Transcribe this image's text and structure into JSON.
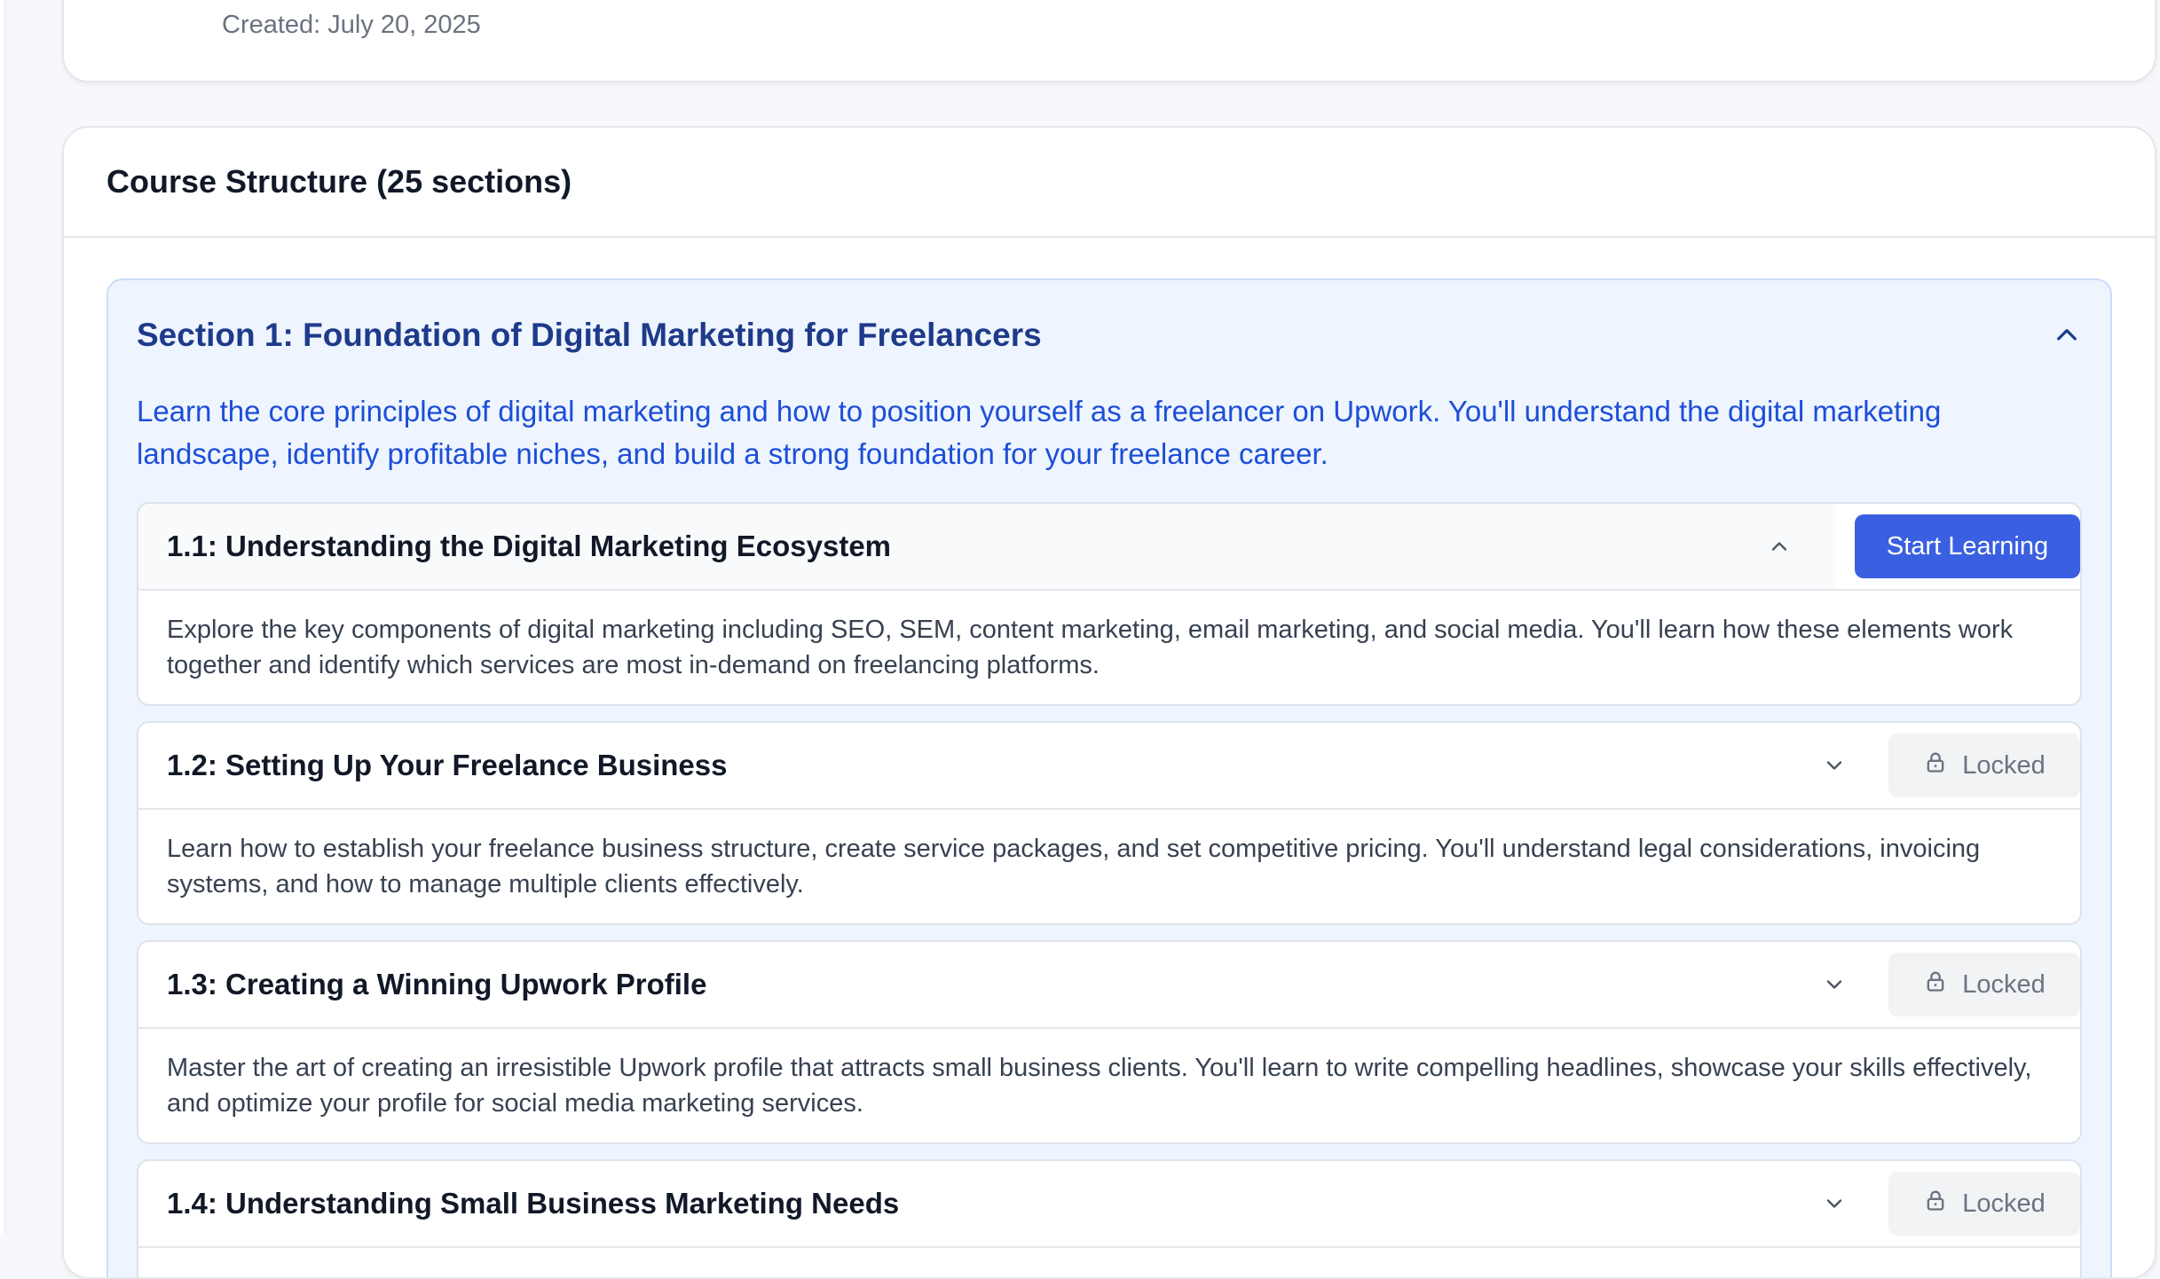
{
  "top_card": {
    "created": "Created: July 20, 2025"
  },
  "course": {
    "title": "Course Structure (25 sections)",
    "section": {
      "title": "Section 1: Foundation of Digital Marketing for Freelancers",
      "description": "Learn the core principles of digital marketing and how to position yourself as a freelancer on Upwork. You'll understand the digital marketing landscape, identify profitable niches, and build a strong foundation for your freelance career.",
      "expanded": true
    },
    "lessons": [
      {
        "title": "1.1: Understanding the Digital Marketing Ecosystem",
        "body": "Explore the key components of digital marketing including SEO, SEM, content marketing, email marketing, and social media. You'll learn how these elements work together and identify which services are most in-demand on freelancing platforms.",
        "action": "Start Learning",
        "state": "available"
      },
      {
        "title": "1.2: Setting Up Your Freelance Business",
        "body": "Learn how to establish your freelance business structure, create service packages, and set competitive pricing. You'll understand legal considerations, invoicing systems, and how to manage multiple clients effectively.",
        "action": "Locked",
        "state": "locked"
      },
      {
        "title": "1.3: Creating a Winning Upwork Profile",
        "body": "Master the art of creating an irresistible Upwork profile that attracts small business clients. You'll learn to write compelling headlines, showcase your skills effectively, and optimize your profile for social media marketing services.",
        "action": "Locked",
        "state": "locked"
      },
      {
        "title": "1.4: Understanding Small Business Marketing Needs",
        "body": "",
        "action": "Locked",
        "state": "locked"
      }
    ]
  },
  "colors": {
    "accent": "#3a5fe0",
    "section_bg": "#eef5fe",
    "section_title": "#1e3a8a",
    "section_desc": "#1d4ed8"
  },
  "icons": {
    "section_toggle": "chevron-up-icon",
    "lesson_open": "chevron-up-icon",
    "lesson_closed": "chevron-down-icon",
    "lock": "lock-icon"
  }
}
